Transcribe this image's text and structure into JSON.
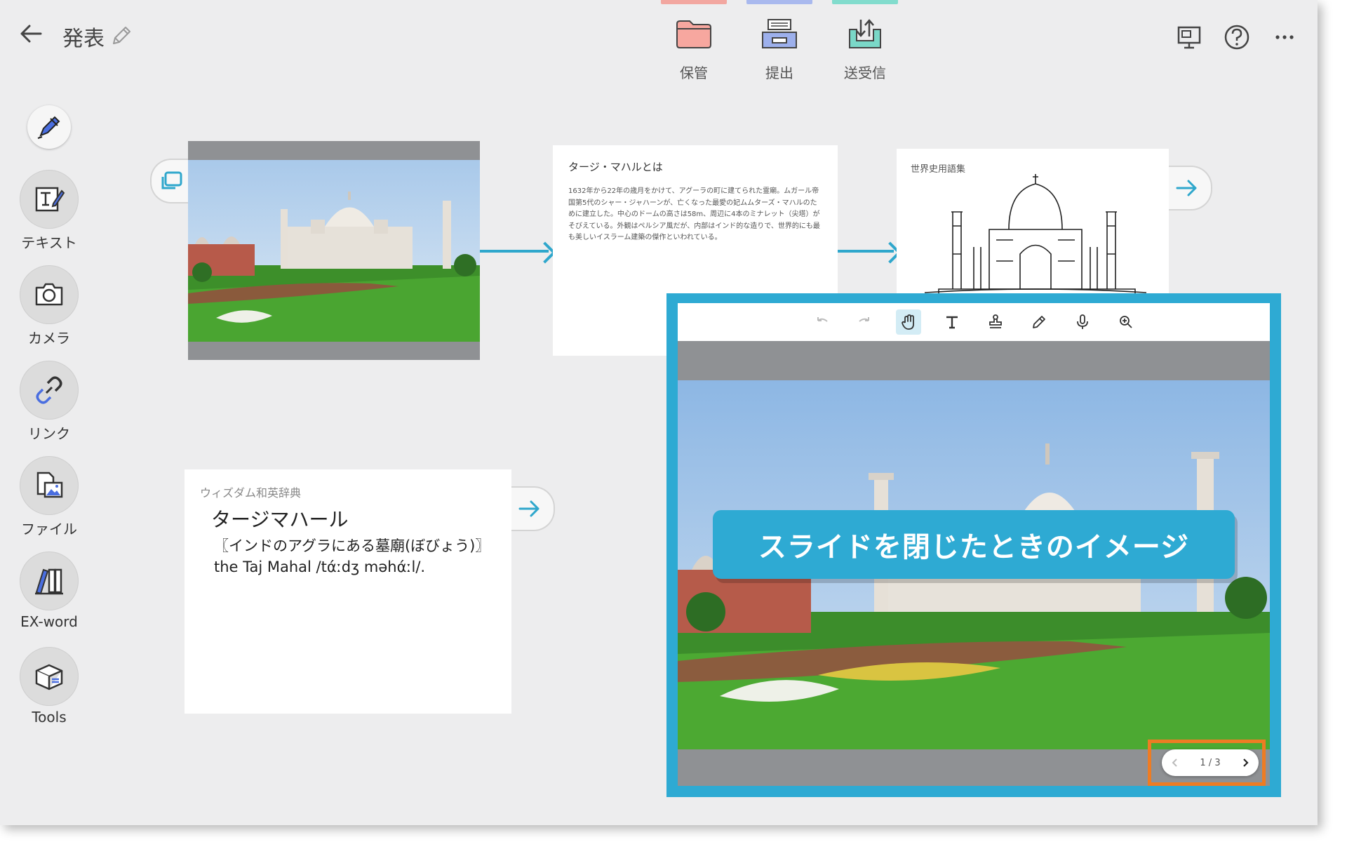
{
  "header": {
    "title": "発表",
    "tools": [
      {
        "label": "保管",
        "color": "#f2a7a0",
        "icon": "folder-icon"
      },
      {
        "label": "提出",
        "color": "#a9b9ee",
        "icon": "tray-icon"
      },
      {
        "label": "送受信",
        "color": "#82dccd",
        "icon": "exchange-icon"
      }
    ],
    "right_icons": [
      "presentation-icon",
      "help-icon",
      "more-icon"
    ]
  },
  "sidebar": {
    "items": [
      {
        "label": "",
        "icon": "pen-icon"
      },
      {
        "label": "テキスト",
        "icon": "text-icon"
      },
      {
        "label": "カメラ",
        "icon": "camera-icon"
      },
      {
        "label": "リンク",
        "icon": "link-icon"
      },
      {
        "label": "ファイル",
        "icon": "file-icon"
      },
      {
        "label": "EX-word",
        "icon": "books-icon"
      },
      {
        "label": "Tools",
        "icon": "tools-box-icon"
      }
    ]
  },
  "cards": {
    "text_card": {
      "title": "タージ・マハルとは",
      "body": "1632年から22年の歳月をかけて、アグーラの町に建てられた霊廟。ムガール帝国第5代のシャー・ジャハーンが、亡くなった最愛の妃ムムターズ・マハルのために建立した。中心のドームの高さは58m、周辺に4本のミナレット（尖塔）がそびえている。外観はペルシア風だが、内部はインド的な造りで、世界的にも最も美しいイスラーム建築の傑作といわれている。"
    },
    "sketch_card": {
      "title": "世界史用語集"
    },
    "dict_card": {
      "source": "ウィズダム和英辞典",
      "word": "タージマハール",
      "definition": "〖インドのアグラにある墓廟(ぼびょう)〗 the Taj Mahal /tάːdʒ məhάːl/."
    }
  },
  "viewer": {
    "tools": [
      "undo-icon",
      "redo-icon",
      "hand-icon",
      "text-tool-icon",
      "stamp-icon",
      "pencil-icon",
      "mic-icon",
      "zoom-icon"
    ],
    "active_tool": "hand-icon",
    "page_indicator": "1 / 3",
    "banner": "スライドを閉じたときのイメージ"
  }
}
